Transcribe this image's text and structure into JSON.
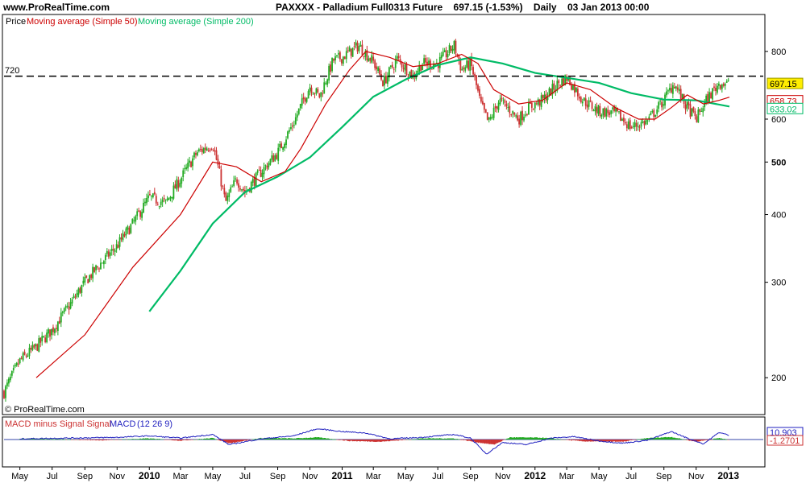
{
  "header": {
    "site": "www.ProRealTime.com",
    "symbol": "PAXXXX - Palladium Full0313 Future",
    "quote": "697.15 (-1.53%)",
    "period": "Daily",
    "date": "03 Jan 2013 00:00"
  },
  "price_panel": {
    "legend_price": "Price",
    "legend_ma50": "Moving average (Simple 50)",
    "legend_ma200": "Moving average (Simple 200)",
    "watermark": "© ProRealTime.com",
    "hline_label": "720"
  },
  "macd_panel": {
    "legend_hist": "MACD minus Signal Signal",
    "legend_macd": "MACD",
    "legend_params": "(12 26 9)"
  },
  "colors": {
    "up": "#22aa22",
    "down": "#cc3333",
    "ma50": "#cc0000",
    "ma200": "#00bb66",
    "macd_line": "#1f1fbf",
    "signal_line": "#3333aa",
    "hline": "#000000",
    "zero_line": "#3344aa",
    "price_badge": "#ffee00"
  },
  "chart_data": [
    {
      "type": "candlestick",
      "title": "PAXXXX - Palladium Full0313 Future",
      "scale": "log",
      "ylim": [
        180,
        880
      ],
      "y_ticks": [
        200,
        300,
        400,
        500,
        600,
        800
      ],
      "x_ticks": [
        "May",
        "Jul",
        "Sep",
        "Nov",
        "2010",
        "Mar",
        "May",
        "Jul",
        "Sep",
        "Nov",
        "2011",
        "Mar",
        "May",
        "Jul",
        "Sep",
        "Nov",
        "2012",
        "Mar",
        "May",
        "Jul",
        "Sep",
        "Nov",
        "2013"
      ],
      "bold_x_ticks": [
        "2010",
        "2011",
        "2012",
        "2013"
      ],
      "horizontal_line": {
        "value": 720,
        "label": "720",
        "style": "dashed"
      },
      "last_values": {
        "price": 697.15,
        "ma50": 658.73,
        "ma200": 633.02
      },
      "price_path": [
        {
          "date": "2009-04-01",
          "close": 188
        },
        {
          "date": "2009-05-01",
          "close": 215
        },
        {
          "date": "2009-06-01",
          "close": 228
        },
        {
          "date": "2009-07-01",
          "close": 245
        },
        {
          "date": "2009-08-01",
          "close": 270
        },
        {
          "date": "2009-09-01",
          "close": 300
        },
        {
          "date": "2009-10-01",
          "close": 325
        },
        {
          "date": "2009-11-01",
          "close": 350
        },
        {
          "date": "2009-12-01",
          "close": 385
        },
        {
          "date": "2010-01-01",
          "close": 430
        },
        {
          "date": "2010-02-01",
          "close": 420
        },
        {
          "date": "2010-03-01",
          "close": 465
        },
        {
          "date": "2010-04-01",
          "close": 520
        },
        {
          "date": "2010-05-01",
          "close": 540
        },
        {
          "date": "2010-05-25",
          "close": 420
        },
        {
          "date": "2010-06-15",
          "close": 465
        },
        {
          "date": "2010-07-01",
          "close": 440
        },
        {
          "date": "2010-08-01",
          "close": 480
        },
        {
          "date": "2010-09-01",
          "close": 520
        },
        {
          "date": "2010-10-01",
          "close": 590
        },
        {
          "date": "2010-11-01",
          "close": 690
        },
        {
          "date": "2010-11-20",
          "close": 660
        },
        {
          "date": "2010-12-15",
          "close": 770
        },
        {
          "date": "2011-01-01",
          "close": 780
        },
        {
          "date": "2011-02-01",
          "close": 820
        },
        {
          "date": "2011-03-01",
          "close": 765
        },
        {
          "date": "2011-03-20",
          "close": 700
        },
        {
          "date": "2011-04-15",
          "close": 775
        },
        {
          "date": "2011-05-15",
          "close": 720
        },
        {
          "date": "2011-06-01",
          "close": 760
        },
        {
          "date": "2011-07-01",
          "close": 760
        },
        {
          "date": "2011-08-01",
          "close": 820
        },
        {
          "date": "2011-08-15",
          "close": 740
        },
        {
          "date": "2011-09-01",
          "close": 760
        },
        {
          "date": "2011-09-20",
          "close": 640
        },
        {
          "date": "2011-10-05",
          "close": 590
        },
        {
          "date": "2011-10-25",
          "close": 650
        },
        {
          "date": "2011-11-10",
          "close": 630
        },
        {
          "date": "2011-12-01",
          "close": 600
        },
        {
          "date": "2011-12-20",
          "close": 630
        },
        {
          "date": "2012-01-15",
          "close": 650
        },
        {
          "date": "2012-02-15",
          "close": 700
        },
        {
          "date": "2012-03-01",
          "close": 715
        },
        {
          "date": "2012-04-01",
          "close": 650
        },
        {
          "date": "2012-05-01",
          "close": 620
        },
        {
          "date": "2012-06-01",
          "close": 615
        },
        {
          "date": "2012-07-01",
          "close": 580
        },
        {
          "date": "2012-08-01",
          "close": 595
        },
        {
          "date": "2012-09-01",
          "close": 650
        },
        {
          "date": "2012-09-20",
          "close": 700
        },
        {
          "date": "2012-10-10",
          "close": 640
        },
        {
          "date": "2012-11-01",
          "close": 600
        },
        {
          "date": "2012-11-20",
          "close": 650
        },
        {
          "date": "2012-12-15",
          "close": 700
        },
        {
          "date": "2013-01-03",
          "close": 697.15
        }
      ],
      "ma50_path": [
        {
          "date": "2009-06-01",
          "value": 200
        },
        {
          "date": "2009-09-01",
          "value": 240
        },
        {
          "date": "2009-12-01",
          "value": 320
        },
        {
          "date": "2010-03-01",
          "value": 400
        },
        {
          "date": "2010-05-01",
          "value": 500
        },
        {
          "date": "2010-06-15",
          "value": 490
        },
        {
          "date": "2010-08-01",
          "value": 460
        },
        {
          "date": "2010-09-15",
          "value": 480
        },
        {
          "date": "2010-10-15",
          "value": 530
        },
        {
          "date": "2010-12-01",
          "value": 640
        },
        {
          "date": "2011-01-15",
          "value": 740
        },
        {
          "date": "2011-02-15",
          "value": 800
        },
        {
          "date": "2011-04-01",
          "value": 780
        },
        {
          "date": "2011-05-15",
          "value": 750
        },
        {
          "date": "2011-07-01",
          "value": 760
        },
        {
          "date": "2011-08-15",
          "value": 790
        },
        {
          "date": "2011-09-15",
          "value": 760
        },
        {
          "date": "2011-10-15",
          "value": 680
        },
        {
          "date": "2011-12-01",
          "value": 640
        },
        {
          "date": "2012-01-15",
          "value": 650
        },
        {
          "date": "2012-03-01",
          "value": 700
        },
        {
          "date": "2012-04-15",
          "value": 680
        },
        {
          "date": "2012-06-01",
          "value": 630
        },
        {
          "date": "2012-07-15",
          "value": 600
        },
        {
          "date": "2012-08-15",
          "value": 600
        },
        {
          "date": "2012-09-15",
          "value": 630
        },
        {
          "date": "2012-10-15",
          "value": 665
        },
        {
          "date": "2012-11-15",
          "value": 640
        },
        {
          "date": "2012-12-15",
          "value": 650
        },
        {
          "date": "2013-01-03",
          "value": 658.73
        }
      ],
      "ma200_path": [
        {
          "date": "2010-01-01",
          "value": 265
        },
        {
          "date": "2010-03-01",
          "value": 315
        },
        {
          "date": "2010-05-01",
          "value": 385
        },
        {
          "date": "2010-07-01",
          "value": 440
        },
        {
          "date": "2010-09-01",
          "value": 470
        },
        {
          "date": "2010-11-01",
          "value": 510
        },
        {
          "date": "2011-01-01",
          "value": 580
        },
        {
          "date": "2011-03-01",
          "value": 660
        },
        {
          "date": "2011-05-01",
          "value": 710
        },
        {
          "date": "2011-07-01",
          "value": 755
        },
        {
          "date": "2011-09-01",
          "value": 780
        },
        {
          "date": "2011-11-01",
          "value": 760
        },
        {
          "date": "2012-01-01",
          "value": 730
        },
        {
          "date": "2012-03-01",
          "value": 715
        },
        {
          "date": "2012-05-01",
          "value": 700
        },
        {
          "date": "2012-07-01",
          "value": 670
        },
        {
          "date": "2012-09-01",
          "value": 652
        },
        {
          "date": "2012-11-01",
          "value": 650
        },
        {
          "date": "2013-01-03",
          "value": 633.02
        }
      ]
    },
    {
      "type": "macd",
      "title": "MACD (12 26 9)",
      "last_values": {
        "macd": "10.903",
        "hist": "-1.2701"
      },
      "macd_path": [
        {
          "date": "2009-05-01",
          "value": 2
        },
        {
          "date": "2009-08-01",
          "value": 4
        },
        {
          "date": "2009-11-01",
          "value": 6
        },
        {
          "date": "2010-01-01",
          "value": 10
        },
        {
          "date": "2010-03-01",
          "value": 4
        },
        {
          "date": "2010-05-01",
          "value": 14
        },
        {
          "date": "2010-06-01",
          "value": -14
        },
        {
          "date": "2010-08-01",
          "value": 2
        },
        {
          "date": "2010-10-01",
          "value": 10
        },
        {
          "date": "2010-11-15",
          "value": 30
        },
        {
          "date": "2011-01-01",
          "value": 22
        },
        {
          "date": "2011-02-15",
          "value": 18
        },
        {
          "date": "2011-04-01",
          "value": 2
        },
        {
          "date": "2011-06-01",
          "value": 6
        },
        {
          "date": "2011-08-01",
          "value": 14
        },
        {
          "date": "2011-09-01",
          "value": 4
        },
        {
          "date": "2011-10-01",
          "value": -40
        },
        {
          "date": "2011-11-01",
          "value": -8
        },
        {
          "date": "2011-12-15",
          "value": -14
        },
        {
          "date": "2012-02-01",
          "value": 4
        },
        {
          "date": "2012-03-15",
          "value": 8
        },
        {
          "date": "2012-05-01",
          "value": -4
        },
        {
          "date": "2012-06-15",
          "value": -10
        },
        {
          "date": "2012-08-01",
          "value": -2
        },
        {
          "date": "2012-09-15",
          "value": 22
        },
        {
          "date": "2012-10-15",
          "value": 4
        },
        {
          "date": "2012-11-15",
          "value": -12
        },
        {
          "date": "2012-12-15",
          "value": 20
        },
        {
          "date": "2013-01-03",
          "value": 10.903
        }
      ],
      "hist_path": [
        {
          "date": "2009-06-01",
          "value": 2
        },
        {
          "date": "2009-10-01",
          "value": -2
        },
        {
          "date": "2010-01-01",
          "value": 3
        },
        {
          "date": "2010-03-01",
          "value": -3
        },
        {
          "date": "2010-05-01",
          "value": 4
        },
        {
          "date": "2010-06-01",
          "value": -10
        },
        {
          "date": "2010-08-01",
          "value": 4
        },
        {
          "date": "2010-10-01",
          "value": 3
        },
        {
          "date": "2010-11-15",
          "value": 6
        },
        {
          "date": "2011-01-15",
          "value": -4
        },
        {
          "date": "2011-03-15",
          "value": -6
        },
        {
          "date": "2011-06-01",
          "value": 3
        },
        {
          "date": "2011-08-01",
          "value": 3
        },
        {
          "date": "2011-09-15",
          "value": -8
        },
        {
          "date": "2011-10-15",
          "value": -14
        },
        {
          "date": "2011-11-15",
          "value": 6
        },
        {
          "date": "2012-01-15",
          "value": 5
        },
        {
          "date": "2012-04-01",
          "value": -5
        },
        {
          "date": "2012-06-15",
          "value": -6
        },
        {
          "date": "2012-08-01",
          "value": 4
        },
        {
          "date": "2012-09-15",
          "value": 7
        },
        {
          "date": "2012-11-01",
          "value": -6
        },
        {
          "date": "2012-12-15",
          "value": 4
        },
        {
          "date": "2013-01-03",
          "value": -1.2701
        }
      ]
    }
  ]
}
